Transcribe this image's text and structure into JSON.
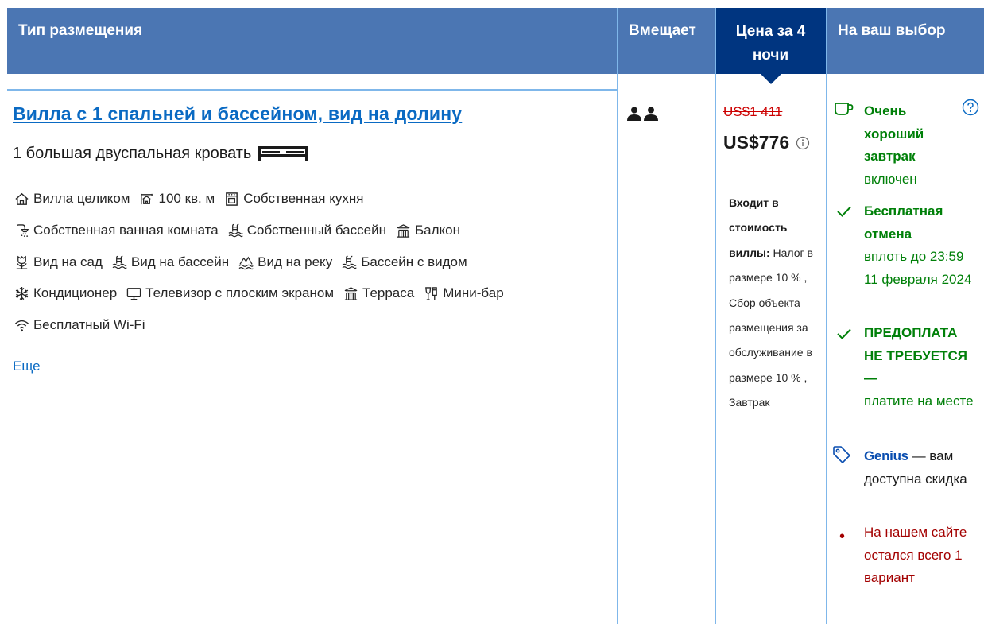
{
  "header": {
    "room_type": "Тип размещения",
    "capacity": "Вмещает",
    "price_line1": "Цена за 4",
    "price_line2": "ночи",
    "choice": "На ваш выбор"
  },
  "room": {
    "title": "Вилла с 1 спальней и бассейном, вид на долину",
    "bed": "1 большая двуспальная кровать",
    "facilities_rows": [
      [
        {
          "icon": "house-icon",
          "label": "Вилла целиком"
        },
        {
          "icon": "area-icon",
          "label": "100 кв. м"
        },
        {
          "icon": "oven-icon",
          "label": "Собственная кухня"
        }
      ],
      [
        {
          "icon": "shower-icon",
          "label": "Собственная ванная комната"
        },
        {
          "icon": "pool-icon",
          "label": "Собственный бассейн"
        },
        {
          "icon": "balcony-icon",
          "label": "Балкон"
        }
      ],
      [
        {
          "icon": "flower-icon",
          "label": "Вид на сад"
        },
        {
          "icon": "pool-icon",
          "label": "Вид на бассейн"
        },
        {
          "icon": "river-icon",
          "label": "Вид на реку"
        },
        {
          "icon": "pool-icon",
          "label": "Бассейн с видом"
        }
      ],
      [
        {
          "icon": "snowflake-icon",
          "label": "Кондиционер"
        },
        {
          "icon": "tv-icon",
          "label": "Телевизор с плоским экраном"
        },
        {
          "icon": "balcony-icon",
          "label": "Терраса"
        },
        {
          "icon": "minibar-icon",
          "label": "Мини-бар"
        }
      ],
      [
        {
          "icon": "wifi-icon",
          "label": "Бесплатный Wi-Fi"
        }
      ]
    ],
    "more_link": "Еще"
  },
  "price": {
    "old": "US$1 411",
    "new": "US$776",
    "included_title": "Входит в стоимость виллы:",
    "included_text": "Налог в размере 10 % , Сбор объекта размещения за обслуживание в размере 10 % , Завтрак"
  },
  "choice": {
    "breakfast_bold": "Очень хороший завтрак",
    "breakfast_rest": "включен",
    "cancel_bold": "Бесплатная отмена",
    "cancel_rest": "вплоть до 23:59 11 февраля 2024",
    "prepay_bold": "ПРЕДОПЛАТА НЕ ТРЕБУЕТСЯ —",
    "prepay_rest": "платите на месте",
    "genius_word": "Genius",
    "genius_rest": "— вам доступна скидка",
    "scarcity": "На нашем сайте остался всего 1 вариант"
  },
  "colors": {
    "header_bg": "#4b76b3",
    "price_header_bg": "#003580",
    "link": "#0a6ac3",
    "green": "#008009",
    "red": "#a30000",
    "genius": "#0a4eb0"
  }
}
